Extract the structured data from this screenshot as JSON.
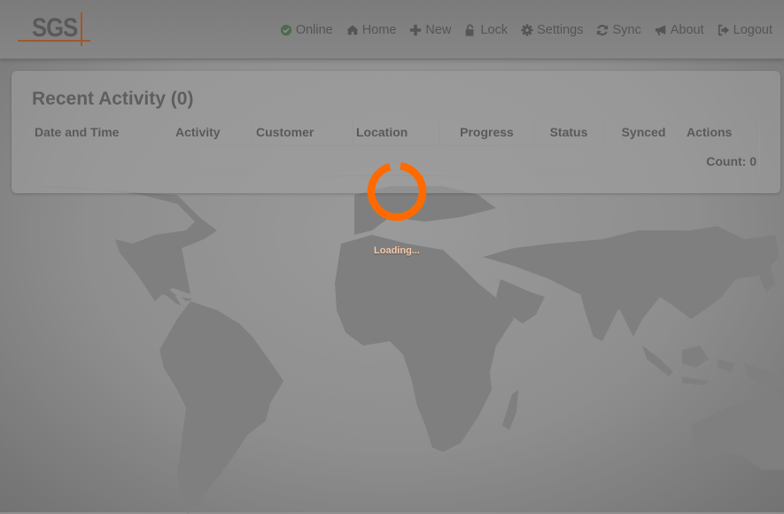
{
  "brand": {
    "logo_text": "SGS",
    "accent_color": "#a0582a"
  },
  "nav": {
    "items": [
      {
        "label": "Online",
        "icon": "check-circle-icon"
      },
      {
        "label": "Home",
        "icon": "home-icon"
      },
      {
        "label": "New",
        "icon": "plus-icon"
      },
      {
        "label": "Lock",
        "icon": "unlock-icon"
      },
      {
        "label": "Settings",
        "icon": "gear-icon"
      },
      {
        "label": "Sync",
        "icon": "refresh-icon"
      },
      {
        "label": "About",
        "icon": "bullhorn-icon"
      },
      {
        "label": "Logout",
        "icon": "sign-out-icon"
      }
    ]
  },
  "recent_activity": {
    "title": "Recent Activity (0)",
    "columns": [
      "Date and Time",
      "Activity",
      "Customer",
      "Location",
      "Progress",
      "Status",
      "Synced",
      "Actions"
    ],
    "rows": [],
    "footer": "Count: 0"
  },
  "loading": {
    "text": "Loading...",
    "spinner_color": "#ff6a00"
  }
}
